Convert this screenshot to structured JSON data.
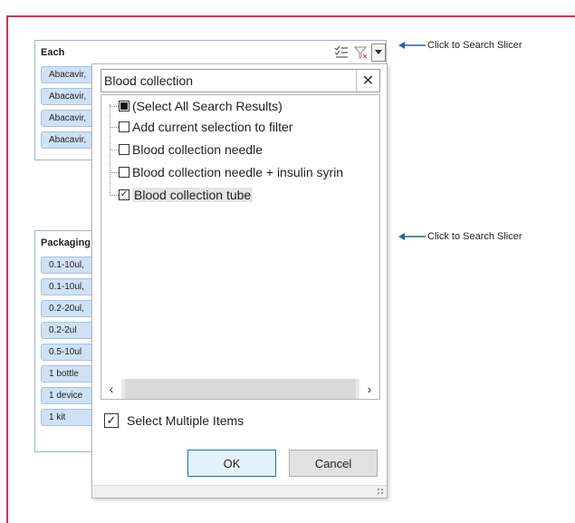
{
  "slicer_each": {
    "title": "Each",
    "chips": [
      "Abacavir,",
      "Abacavir,",
      "Abacavir,",
      "Abacavir,"
    ]
  },
  "slicer_packaging": {
    "title": "Packaging",
    "chips": [
      "0.1-10ul,",
      "0.1-10ul,",
      "0.2-20ul,",
      "0.2-2ul",
      "0.5-10ul",
      "1 bottle",
      "1 device",
      "1 kit"
    ]
  },
  "callouts": {
    "top": "Click to Search Slicer",
    "bottom": "Click to Search Slicer"
  },
  "popup": {
    "search_value": "Blood collection",
    "items": [
      {
        "label": "(Select All Search Results)",
        "state": "indeterminate"
      },
      {
        "label": "Add current selection to filter",
        "state": "unchecked"
      },
      {
        "label": "Blood collection needle",
        "state": "unchecked"
      },
      {
        "label": "Blood collection needle + insulin syrin",
        "state": "unchecked"
      },
      {
        "label": "Blood collection tube",
        "state": "checked"
      }
    ],
    "select_multiple_label": "Select Multiple Items",
    "select_multiple_checked": true,
    "ok_label": "OK",
    "cancel_label": "Cancel"
  },
  "icons": {
    "multi_select": "multi-select-icon",
    "clear_filter": "clear-filter-icon",
    "dropdown": "dropdown-arrow-icon",
    "close": "close-icon",
    "arrow": "left-arrow-icon"
  },
  "colors": {
    "frame": "#d6334b",
    "chip": "#cfe1f5",
    "callout_arrow": "#2e5f9e"
  }
}
